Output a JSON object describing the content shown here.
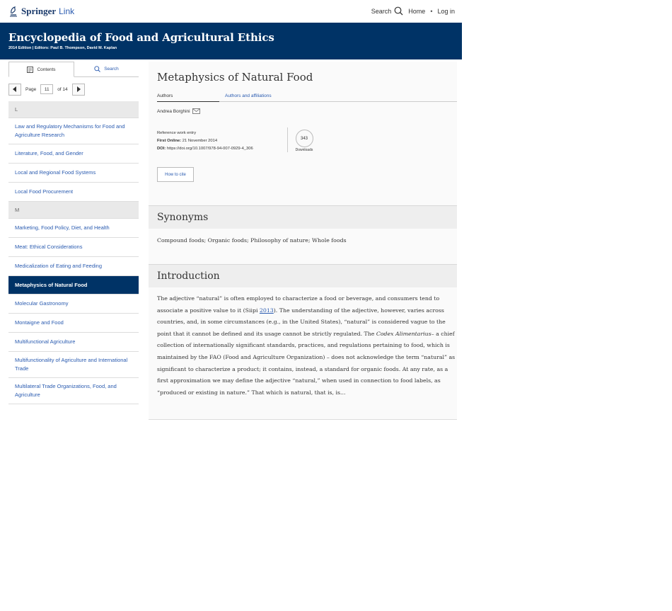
{
  "topbar": {
    "logo_brand": "Springer",
    "logo_link": "Link",
    "search_label": "Search",
    "home_label": "Home",
    "separator": "•",
    "login_label": "Log in"
  },
  "header": {
    "title": "Encyclopedia of Food and Agricultural Ethics",
    "subtitle": "2014 Edition | Editors: Paul B. Thompson, David M. Kaplan"
  },
  "sidebar": {
    "tabs": {
      "contents": "Contents",
      "search": "Search"
    },
    "pager": {
      "page_label": "Page",
      "page_value": "11",
      "of_label": "of 14"
    },
    "toc": {
      "letter_l": "L",
      "law": "Law and Regulatory Mechanisms for Food and Agriculture Research",
      "literature": "Literature, Food, and Gender",
      "local_regional": "Local and Regional Food Systems",
      "local_procurement": "Local Food Procurement",
      "letter_m": "M",
      "marketing": "Marketing, Food Policy, Diet, and Health",
      "meat": "Meat: Ethical Considerations",
      "medicalization": "Medicalization of Eating and Feeding",
      "metaphysics": "Metaphysics of Natural Food",
      "molecular": "Molecular Gastronomy",
      "montaigne": "Montaigne and Food",
      "multifunctional": "Multifunctional Agriculture",
      "multifunctionality": "Multifunctionality of Agriculture and International Trade",
      "multilateral": "Multilateral Trade Organizations, Food, and Agriculture"
    }
  },
  "article": {
    "title": "Metaphysics of Natural Food",
    "tabs": {
      "authors": "Authors",
      "affiliations": "Authors and affiliations"
    },
    "author": "Andrea Borghini",
    "meta": {
      "type": "Reference work entry",
      "first_online_label": "First Online:",
      "first_online_value": "21 November 2014",
      "doi_label": "DOI:",
      "doi_value": "https://doi.org/10.1007/978-94-007-0929-4_306"
    },
    "downloads": {
      "count": "343",
      "label": "Downloads"
    },
    "cite_label": "How to cite",
    "synonyms": {
      "heading": "Synonyms",
      "text": "Compound foods; Organic foods; Philosophy of nature; Whole foods"
    },
    "introduction": {
      "heading": "Introduction",
      "p1": "The adjective “natural” is often employed to characterize a food or beverage, and consumers tend to associate a positive value to it (Siipi ",
      "ref": "2013",
      "p2": "). The understanding of the adjective, however, varies across countries, and, in some circumstances (e.g., in the United States), “natural” is considered vague to the point that it cannot be defined and its usage cannot be strictly regulated. The ",
      "codex": "Codex Alimentarius",
      "p3": "– a chief collection of internationally significant standards, practices, and regulations pertaining to food, which is maintained by the FAO (Food and Agriculture Organization) – does not acknowledge the term “natural” as significant to characterize a product; it contains, instead, a standard for organic foods. At any rate, as a first approximation we may define the adjective “natural,” when used in connection to food labels, as “produced or existing in nature.” That which is natural, that is, is..."
    }
  }
}
